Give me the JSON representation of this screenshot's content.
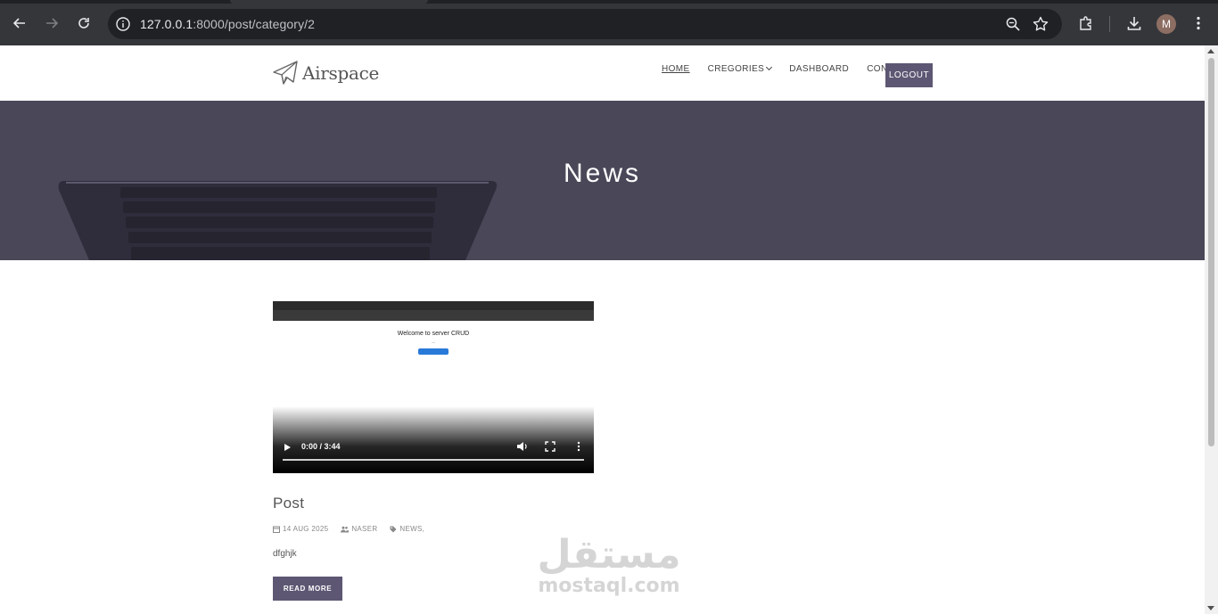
{
  "browser": {
    "url_host": "127.0.0.1",
    "url_rest": ":8000/post/category/2",
    "profile_initial": "M"
  },
  "site": {
    "logo_text": "Airspace",
    "nav": {
      "home": "HOME",
      "categories": "CREGORIES",
      "dashboard": "DASHBOARD",
      "contact": "CONTACT",
      "logout": "LOGOUT"
    },
    "hero_title": "News"
  },
  "post": {
    "video": {
      "preview_title": "Welcome to server CRUD",
      "time": "0:00 / 3:44"
    },
    "title": "Post",
    "date": "14 AUG 2025",
    "author": "NASER",
    "category": "NEWS,",
    "excerpt": "dfghjk",
    "read_more": "READ MORE"
  },
  "watermark": {
    "arabic": "مستقل",
    "latin": "mostaql.com"
  },
  "colors": {
    "accent": "#5d5773",
    "hero_bg": "#4a4758"
  }
}
